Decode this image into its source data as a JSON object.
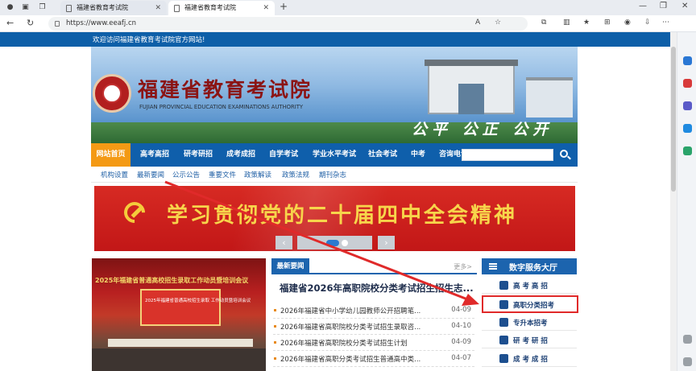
{
  "browser": {
    "tabs": [
      {
        "title": "福建省教育考试院",
        "active": false
      },
      {
        "title": "福建省教育考试院",
        "active": true
      }
    ],
    "new_tab_label": "+",
    "url": "https://www.eeafj.cn"
  },
  "site": {
    "welcome": "欢迎访问福建省教育考试院官方网站!",
    "name": "福建省教育考试院",
    "name_en": "FUJIAN PROVINCIAL EDUCATION EXAMINATIONS AUTHORITY",
    "slogan": "公平 公正 公开"
  },
  "main_nav": [
    "网站首页",
    "高考高招",
    "研考研招",
    "成考成招",
    "自学考试",
    "学业水平考试",
    "社会考试",
    "中考",
    "咨询电话"
  ],
  "sub_nav": [
    "机构设置",
    "最新要闻",
    "公示公告",
    "重要文件",
    "政策解读",
    "政策法规",
    "期刊杂志"
  ],
  "carousel": {
    "slogan": "学习贯彻党的二十届四中全会精神",
    "prev": "‹",
    "next": "›"
  },
  "photo_news": {
    "title": "2025年福建省普通高校招生录取工作动员暨培训会议",
    "screen_text": "2025年福建省普通高校招生录取 工作动员暨培训会议"
  },
  "news": {
    "tab": "最新要闻",
    "more": "更多>",
    "headline": "福建省2026年高职院校分类考试招生招生志...",
    "items": [
      {
        "title": "2026年福建省中小学幼儿园教师公开招聘笔...",
        "date": "04-09"
      },
      {
        "title": "2026年福建省高职院校分类考试招生录取咨...",
        "date": "04-10"
      },
      {
        "title": "2026年福建省高职院校分类考试招生计划",
        "date": "04-09"
      },
      {
        "title": "2026年福建省高职分类考试招生普通高中类...",
        "date": "04-07"
      }
    ]
  },
  "services": {
    "title": "数字服务大厅",
    "items": [
      {
        "label": "高 考 高 招"
      },
      {
        "label": "高职分类招考"
      },
      {
        "label": "专升本招考"
      },
      {
        "label": "研 考 研 招"
      },
      {
        "label": "成 考 成 招"
      }
    ]
  },
  "colors": {
    "nav_blue": "#0f5fab",
    "home_orange": "#f49a15",
    "highlight_red": "#e02a2a",
    "banner_gold": "#f7d54b"
  }
}
